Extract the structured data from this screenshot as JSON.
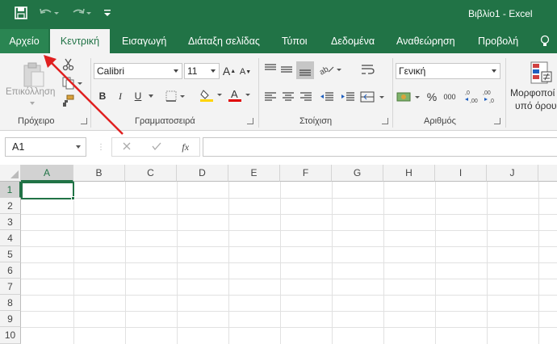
{
  "titlebar": {
    "title": "Βιβλίο1  -  Excel",
    "qat": [
      "save-icon",
      "undo-icon",
      "redo-icon",
      "customize-qat-icon"
    ]
  },
  "tabs": [
    "Αρχείο",
    "Κεντρική",
    "Εισαγωγή",
    "Διάταξη σελίδας",
    "Τύποι",
    "Δεδομένα",
    "Αναθεώρηση",
    "Προβολή"
  ],
  "ribbon": {
    "clipboard": {
      "paste_label": "Επικόλληση",
      "group_label": "Πρόχειρο"
    },
    "font": {
      "font_name": "Calibri",
      "font_size": "11",
      "group_label": "Γραμματοσειρά",
      "bold": "B",
      "italic": "I",
      "underline": "U"
    },
    "alignment": {
      "group_label": "Στοίχιση"
    },
    "number": {
      "format": "Γενική",
      "percent": "%",
      "comma": "000",
      "group_label": "Αριθμός"
    },
    "styles": {
      "label_line1": "Μορφοποί",
      "label_line2": "υπό όρου"
    }
  },
  "formula_bar": {
    "name_box": "A1",
    "fx": "fx"
  },
  "sheet": {
    "columns": [
      "A",
      "B",
      "C",
      "D",
      "E",
      "F",
      "G",
      "H",
      "I",
      "J"
    ],
    "rows": [
      "1",
      "2",
      "3",
      "4",
      "5",
      "6",
      "7",
      "8",
      "9",
      "10"
    ],
    "selected_cell": "A1"
  },
  "annotation": {
    "color": "#e02020"
  },
  "colors": {
    "accent": "#217346"
  }
}
